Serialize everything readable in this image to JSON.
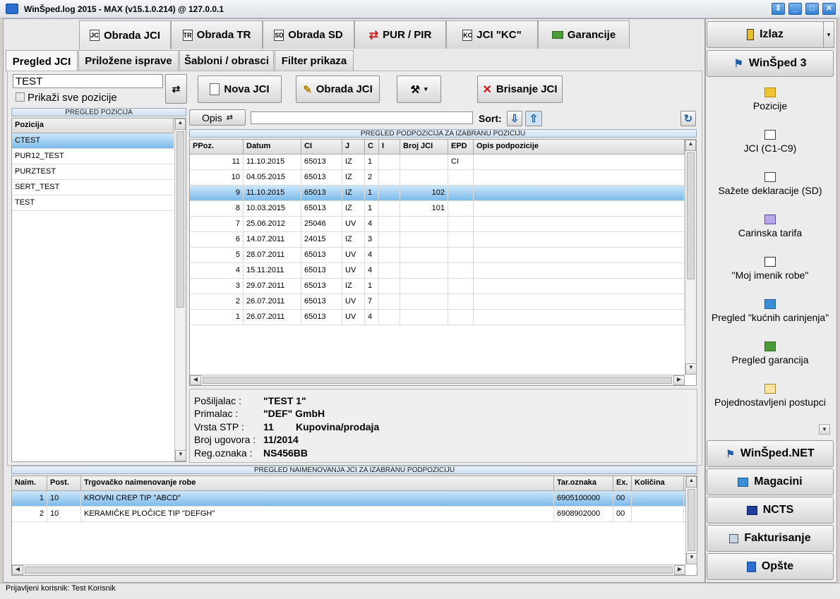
{
  "window": {
    "title": "WinŠped.log 2015 - MAX (v15.1.0.214) @ 127.0.0.1"
  },
  "top_tabs": [
    {
      "label": "Obrada JCI",
      "icon": "document-icon"
    },
    {
      "label": "Obrada TR",
      "icon": "document-tr-icon"
    },
    {
      "label": "Obrada SD",
      "icon": "document-sd-icon"
    },
    {
      "label": "PUR / PIR",
      "icon": "arrows-icon"
    },
    {
      "label": "JCI \"KC\"",
      "icon": "document-kc-icon"
    },
    {
      "label": "Garancije",
      "icon": "money-icon"
    }
  ],
  "sub_tabs": [
    "Pregled JCI",
    "Priložene isprave",
    "Šabloni / obrasci",
    "Filter prikaza"
  ],
  "filter": {
    "value": "TEST",
    "checkbox_label": "Prikaži sve pozicije"
  },
  "actions": {
    "new": "Nova JCI",
    "process": "Obrada JCI",
    "delete": "Brisanje JCI"
  },
  "opis": {
    "label": "Opis",
    "value": "",
    "sort_label": "Sort:"
  },
  "positions": {
    "caption": "PREGLED POZICIJA",
    "header": "Pozicija",
    "items": [
      "CTEST",
      "PUR12_TEST",
      "PURZTEST",
      "SERT_TEST",
      "TEST"
    ]
  },
  "subpositions": {
    "caption": "PREGLED PODPOZICIJA ZA IZABRANU POZICIJU",
    "headers": [
      "PPoz.",
      "Datum",
      "CI",
      "J",
      "C",
      "I",
      "Broj JCI",
      "EPD",
      "Opis podpozicije"
    ],
    "rows": [
      [
        "11",
        "11.10.2015",
        "65013",
        "IZ",
        "1",
        "",
        "",
        "CI",
        ""
      ],
      [
        "10",
        "04.05.2015",
        "65013",
        "IZ",
        "2",
        "",
        "",
        "",
        ""
      ],
      [
        "9",
        "11.10.2015",
        "65013",
        "IZ",
        "1",
        "",
        "102",
        "",
        ""
      ],
      [
        "8",
        "10.03.2015",
        "65013",
        "IZ",
        "1",
        "",
        "101",
        "",
        ""
      ],
      [
        "7",
        "25.06.2012",
        "25046",
        "UV",
        "4",
        "",
        "",
        "",
        ""
      ],
      [
        "6",
        "14.07.2011",
        "24015",
        "IZ",
        "3",
        "",
        "",
        "",
        ""
      ],
      [
        "5",
        "28.07.2011",
        "65013",
        "UV",
        "4",
        "",
        "",
        "",
        ""
      ],
      [
        "4",
        "15.11.2011",
        "65013",
        "UV",
        "4",
        "",
        "",
        "",
        ""
      ],
      [
        "3",
        "29.07.2011",
        "65013",
        "IZ",
        "1",
        "",
        "",
        "",
        ""
      ],
      [
        "2",
        "26.07.2011",
        "65013",
        "UV",
        "7",
        "",
        "",
        "",
        ""
      ],
      [
        "1",
        "26.07.2011",
        "65013",
        "UV",
        "4",
        "",
        "",
        "",
        ""
      ]
    ]
  },
  "details": {
    "sender_label": "Pošiljalac :",
    "sender": "\"TEST 1\"",
    "receiver_label": "Primalac :",
    "receiver": "\"DEF\" GmbH",
    "stp_label": "Vrsta STP :",
    "stp_code": "11",
    "stp_name": "Kupovina/prodaja",
    "contract_label": "Broj ugovora :",
    "contract": "11/2014",
    "reg_label": "Reg.oznaka :",
    "reg": "NS456BB"
  },
  "goods": {
    "caption": "PREGLED NAIMENOVANJA JCI ZA IZABRANU PODPOZICIJU",
    "headers": [
      "Naim.",
      "Post.",
      "Trgovačko naimenovanje robe",
      "Tar.oznaka",
      "Ex.",
      "Količina"
    ],
    "rows": [
      [
        "1",
        "10",
        "KROVNI CREP TIP \"ABCD\"",
        "6905100000",
        "00",
        ""
      ],
      [
        "2",
        "10",
        "KERAMIČKE PLOČICE TIP \"DEFGH\"",
        "6908902000",
        "00",
        ""
      ]
    ]
  },
  "right_panel": {
    "exit": "Izlaz",
    "winsped3": "WinŠped 3",
    "nav": [
      "Pozicije",
      "JCI (C1-C9)",
      "Sažete deklaracije (SD)",
      "Carinska tarifa",
      "\"Moj imenik robe\"",
      "Pregled \"kućnih carinjenja\"",
      "Pregled garancija",
      "Pojednostavljeni postupci"
    ],
    "bottom": [
      "WinŠped.NET",
      "Magacini",
      "NCTS",
      "Fakturisanje",
      "Opšte"
    ]
  },
  "status": "Prijavljeni korisnik: Test Korisnik",
  "colors": {
    "selection": "#7cbbeb",
    "accent": "#2f7fd4"
  }
}
